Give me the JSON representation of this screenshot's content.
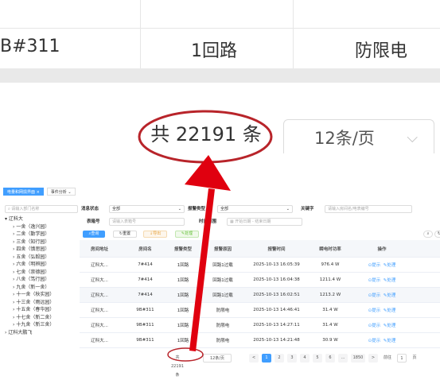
{
  "zoom": {
    "row_text": [
      "B#311",
      "1回路",
      "防限电"
    ],
    "total_text": "共 22191 条",
    "page_size": "12条/页"
  },
  "tabs": [
    "电量和网损界面",
    "事件分析"
  ],
  "tree": {
    "search_placeholder": "请输入部门名称",
    "root": "辽科大",
    "children": [
      "一舍（逸兴园）",
      "二舍（勤学园）",
      "三舍（知行园）",
      "四舍（慎思园）",
      "五舍（弘毅园）",
      "六舍（明辨园）",
      "七舍（崇德园）",
      "八舍（笃行园）",
      "九舍（新一舍）",
      "十一舍（秋实园）",
      "十三舍（雨远园）",
      "十五舍（春华园）",
      "十七舍（新二舍）",
      "十九舍（新三舍）"
    ],
    "root2": "辽科大鹏飞"
  },
  "filters": {
    "status_label": "消息状态",
    "status_value": "全部",
    "alarm_type_label": "报警类型",
    "alarm_type_value": "全部",
    "keyword_label": "关键字",
    "keyword_placeholder": "请输入房间名/电表编号",
    "meter_label": "表箱号",
    "meter_placeholder": "请输入表箱号",
    "time_label": "时间范围",
    "time_start": "开始日期",
    "time_sep": "-",
    "time_end": "结束日期"
  },
  "buttons": {
    "search": "查询",
    "reset": "重置",
    "export": "导出",
    "handle": "处理"
  },
  "table": {
    "columns": [
      "房间地址",
      "房间名",
      "报警类型",
      "报警原因",
      "报警时间",
      "瞬电时功率",
      "操作"
    ],
    "rows": [
      [
        "辽科大...",
        "7#414",
        "1回路",
        "回路1过载",
        "2025-10-13 16:05:39",
        "976.4 W"
      ],
      [
        "辽科大...",
        "7#414",
        "1回路",
        "回路1过载",
        "2025-10-13 16:04:38",
        "1211.4 W"
      ],
      [
        "辽科大...",
        "7#414",
        "1回路",
        "回路1过载",
        "2025-10-13 16:02:51",
        "1213.2 W"
      ],
      [
        "辽科大...",
        "9B#311",
        "1回路",
        "防限电",
        "2025-10-13 14:46:41",
        "31.4 W"
      ],
      [
        "辽科大...",
        "9B#311",
        "1回路",
        "防限电",
        "2025-10-13 14:27:11",
        "31.4 W"
      ],
      [
        "辽科大...",
        "9B#311",
        "1回路",
        "防限电",
        "2025-10-13 14:21:48",
        "30.9 W"
      ]
    ],
    "op_remind": "提示",
    "op_handle": "处理"
  },
  "pager": {
    "total": "共 22191 条",
    "size": "12条/页",
    "prev": "<",
    "pages": [
      "1",
      "2",
      "3",
      "4",
      "5",
      "6",
      "...",
      "1850"
    ],
    "next": ">",
    "goto": "前往",
    "goto_value": "1",
    "suffix": "页"
  },
  "colors": {
    "accent": "#409eff",
    "annotation": "#e0000f",
    "annotation_oval": "#b8242a"
  }
}
